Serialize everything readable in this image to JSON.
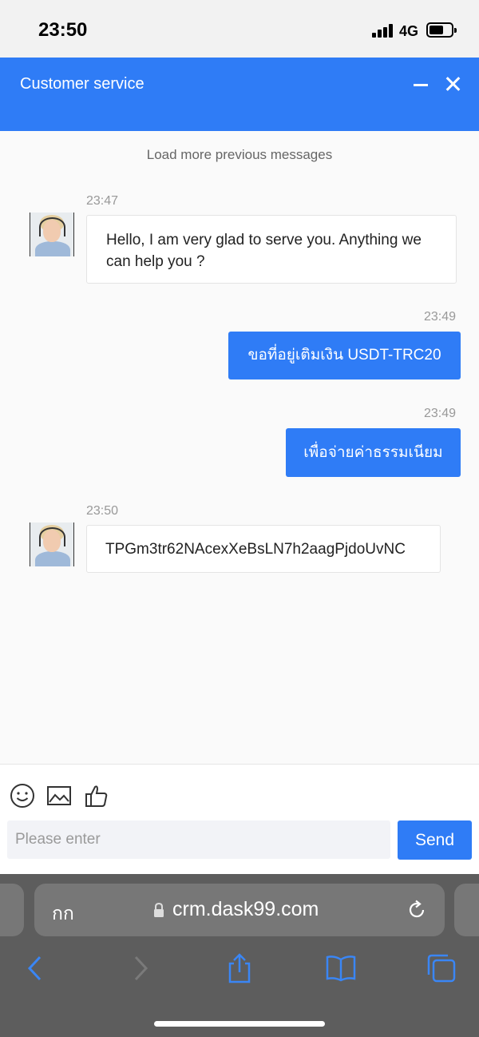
{
  "status_bar": {
    "time": "23:50",
    "network": "4G"
  },
  "header": {
    "title": "Customer service"
  },
  "chat": {
    "load_more": "Load more previous messages",
    "messages": [
      {
        "direction": "incoming",
        "time": "23:47",
        "text": "Hello, I am very glad to serve you. Anything we can help you ?"
      },
      {
        "direction": "outgoing",
        "time": "23:49",
        "text": "ขอที่อยู่เติมเงิน USDT-TRC20"
      },
      {
        "direction": "outgoing",
        "time": "23:49",
        "text": "เพื่อจ่ายค่าธรรมเนียม"
      },
      {
        "direction": "incoming",
        "time": "23:50",
        "text": "TPGm3tr62NAcexXeBsLN7h2aagPjdoUvNC"
      }
    ]
  },
  "composer": {
    "placeholder": "Please enter",
    "send_label": "Send"
  },
  "browser": {
    "text_size_label": "กก",
    "url": "crm.dask99.com"
  },
  "colors": {
    "accent": "#2f7cf6",
    "browser_chrome": "#5d5d5d",
    "browser_icon": "#3a86f5"
  }
}
